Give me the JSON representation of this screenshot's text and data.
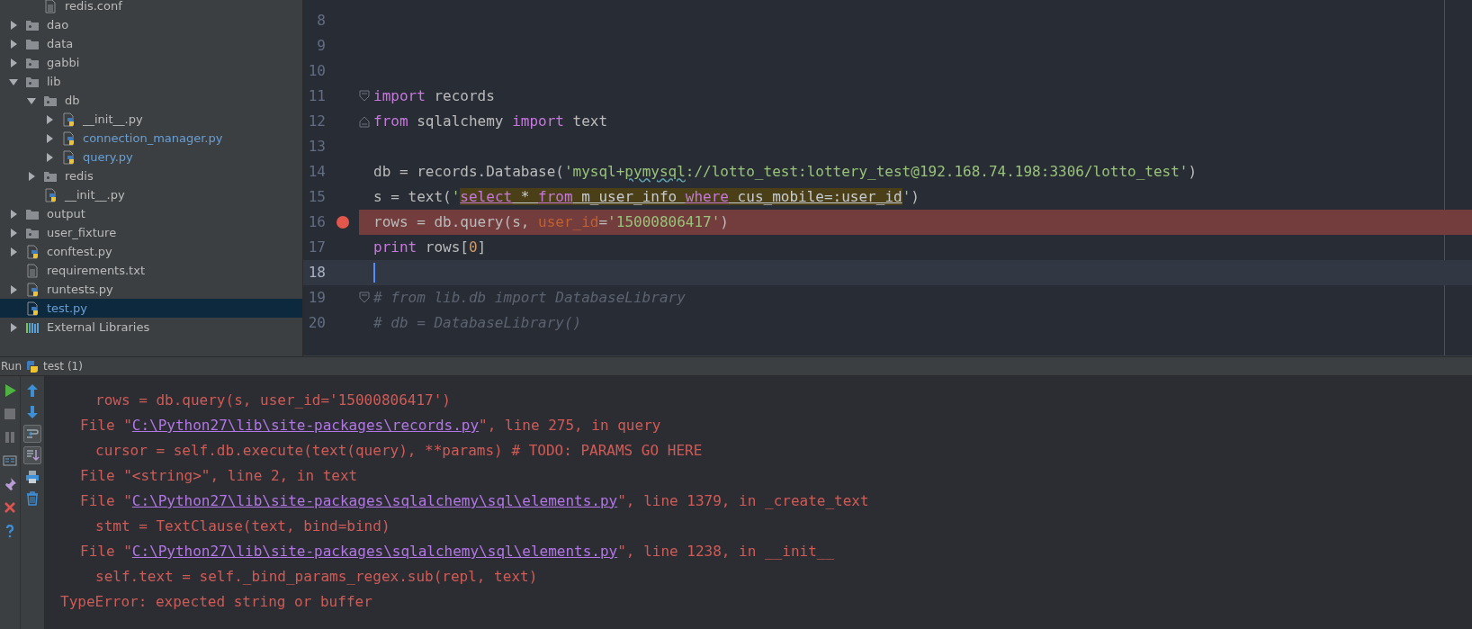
{
  "project_tree": {
    "continued_children": [
      {
        "label": "redis.conf",
        "kind": "text",
        "selected": false,
        "modified": false
      }
    ],
    "items": [
      {
        "label": "dao",
        "kind": "package",
        "expanded": false,
        "selected": false,
        "modified": false
      },
      {
        "label": "data",
        "kind": "folder",
        "expanded": false,
        "selected": false,
        "modified": false
      },
      {
        "label": "gabbi",
        "kind": "package",
        "expanded": false,
        "selected": false,
        "modified": false
      },
      {
        "label": "lib",
        "kind": "package",
        "expanded": true,
        "selected": false,
        "modified": false,
        "children": [
          {
            "label": "db",
            "kind": "package",
            "expanded": true,
            "selected": false,
            "modified": false,
            "children": [
              {
                "label": "__init__.py",
                "kind": "python",
                "expanded": false,
                "selected": false,
                "modified": false
              },
              {
                "label": "connection_manager.py",
                "kind": "python",
                "expanded": false,
                "selected": false,
                "modified": true
              },
              {
                "label": "query.py",
                "kind": "python",
                "expanded": false,
                "selected": false,
                "modified": true
              }
            ]
          },
          {
            "label": "redis",
            "kind": "package",
            "expanded": false,
            "selected": false,
            "modified": false
          },
          {
            "label": "__init__.py",
            "kind": "python",
            "selected": false,
            "modified": false
          }
        ]
      },
      {
        "label": "output",
        "kind": "folder",
        "expanded": false,
        "selected": false,
        "modified": false
      },
      {
        "label": "user_fixture",
        "kind": "package",
        "expanded": false,
        "selected": false,
        "modified": false
      },
      {
        "label": "conftest.py",
        "kind": "python",
        "expanded": false,
        "selected": false,
        "modified": false
      },
      {
        "label": "requirements.txt",
        "kind": "text",
        "selected": false,
        "modified": false
      },
      {
        "label": "runtests.py",
        "kind": "python",
        "expanded": false,
        "selected": false,
        "modified": false
      },
      {
        "label": "test.py",
        "kind": "python",
        "selected": true,
        "modified": true
      },
      {
        "label": "External Libraries",
        "kind": "library",
        "expanded": false,
        "selected": false,
        "modified": false
      }
    ]
  },
  "editor": {
    "lines": [
      {
        "number": "8",
        "kind": "plain",
        "breakpoint": false,
        "current": false
      },
      {
        "number": "9",
        "kind": "plain",
        "breakpoint": false,
        "current": false
      },
      {
        "number": "10",
        "kind": "plain",
        "breakpoint": false,
        "current": false
      },
      {
        "number": "11",
        "kind": "fold-start",
        "breakpoint": false,
        "current": false,
        "tokens": [
          {
            "kind": "keyword",
            "text": "import"
          },
          {
            "kind": "plain",
            "text": " records"
          }
        ]
      },
      {
        "number": "12",
        "kind": "fold-end",
        "breakpoint": false,
        "current": false,
        "tokens": [
          {
            "kind": "keyword",
            "text": "from"
          },
          {
            "kind": "plain",
            "text": " sqlalchemy "
          },
          {
            "kind": "keyword",
            "text": "import"
          },
          {
            "kind": "plain",
            "text": " text"
          }
        ]
      },
      {
        "number": "13",
        "kind": "plain",
        "breakpoint": false,
        "current": false
      },
      {
        "number": "14",
        "kind": "plain",
        "breakpoint": false,
        "current": false,
        "tokens": [
          {
            "kind": "plain",
            "text": "db = records.Database("
          },
          {
            "kind": "string",
            "text": "'mysql+"
          },
          {
            "kind": "typo",
            "text": "pymysql"
          },
          {
            "kind": "string",
            "text": "://lotto_test:lottery_test@192.168.74.198:3306/lotto_test'"
          },
          {
            "kind": "plain",
            "text": ")"
          }
        ]
      },
      {
        "number": "15",
        "kind": "plain",
        "breakpoint": false,
        "current": false,
        "tokens": [
          {
            "kind": "plain",
            "text": "s = text("
          },
          {
            "kind": "string",
            "text": "'"
          },
          {
            "kind": "sql-keyword",
            "text": "select"
          },
          {
            "kind": "sql",
            "text": " * "
          },
          {
            "kind": "sql-keyword",
            "text": "from"
          },
          {
            "kind": "sql",
            "text": " m_user_info "
          },
          {
            "kind": "sql-keyword",
            "text": "where"
          },
          {
            "kind": "sql",
            "text": " cus_mobile=:user_id"
          },
          {
            "kind": "string",
            "text": "'"
          },
          {
            "kind": "plain",
            "text": ")"
          }
        ]
      },
      {
        "number": "16",
        "kind": "plain",
        "breakpoint": true,
        "current": false,
        "tokens": [
          {
            "kind": "plain",
            "text": "rows = db.query(s, "
          },
          {
            "kind": "param",
            "text": "user_id"
          },
          {
            "kind": "plain",
            "text": "="
          },
          {
            "kind": "string",
            "text": "'15000806417'"
          },
          {
            "kind": "plain",
            "text": ")"
          }
        ]
      },
      {
        "number": "17",
        "kind": "plain",
        "breakpoint": false,
        "current": false,
        "tokens": [
          {
            "kind": "keyword",
            "text": "print"
          },
          {
            "kind": "plain",
            "text": " rows["
          },
          {
            "kind": "number",
            "text": "0"
          },
          {
            "kind": "plain",
            "text": "]"
          }
        ]
      },
      {
        "number": "18",
        "kind": "plain",
        "breakpoint": false,
        "current": true
      },
      {
        "number": "19",
        "kind": "fold-start",
        "breakpoint": false,
        "current": false,
        "tokens": [
          {
            "kind": "comment",
            "text": "# from lib.db import DatabaseLibrary"
          }
        ]
      },
      {
        "number": "20",
        "kind": "plain",
        "breakpoint": false,
        "current": false,
        "tokens": [
          {
            "kind": "comment",
            "text": "# db = DatabaseLibrary()"
          }
        ]
      }
    ]
  },
  "run_panel": {
    "title": "Run",
    "tab": "test (1)",
    "toolbar_1": [
      {
        "kind": "run",
        "disabled": false
      },
      {
        "kind": "stop",
        "disabled": true
      },
      {
        "kind": "pause",
        "disabled": true
      },
      {
        "kind": "layout",
        "disabled": false
      },
      {
        "kind": "pin",
        "disabled": false
      },
      {
        "kind": "close",
        "disabled": false
      },
      {
        "kind": "help",
        "disabled": false
      }
    ],
    "toolbar_2": [
      {
        "kind": "up",
        "on": false
      },
      {
        "kind": "down",
        "on": false
      },
      {
        "kind": "wrap",
        "on": true
      },
      {
        "kind": "scroll-end",
        "on": true
      },
      {
        "kind": "print",
        "on": false
      },
      {
        "kind": "trash",
        "on": false
      }
    ],
    "console": [
      {
        "kind": "source",
        "text": "rows = db.query(s, user_id='15000806417')"
      },
      {
        "kind": "frame",
        "before": "File \"",
        "link": "C:\\Python27\\lib\\site-packages\\records.py",
        "after": "\", line 275, in query"
      },
      {
        "kind": "source",
        "text": "cursor = self.db.execute(text(query), **params) # TODO: PARAMS GO HERE"
      },
      {
        "kind": "frame",
        "before": "File \"<string>\", line 2, in text"
      },
      {
        "kind": "frame",
        "before": "File \"",
        "link": "C:\\Python27\\lib\\site-packages\\sqlalchemy\\sql\\elements.py",
        "after": "\", line 1379, in _create_text"
      },
      {
        "kind": "source",
        "text": "stmt = TextClause(text, bind=bind)"
      },
      {
        "kind": "frame",
        "before": "File \"",
        "link": "C:\\Python27\\lib\\site-packages\\sqlalchemy\\sql\\elements.py",
        "after": "\", line 1238, in __init__"
      },
      {
        "kind": "source",
        "text": "self.text = self._bind_params_regex.sub(repl, text)"
      },
      {
        "kind": "error",
        "text": "TypeError: expected string or buffer"
      }
    ]
  }
}
